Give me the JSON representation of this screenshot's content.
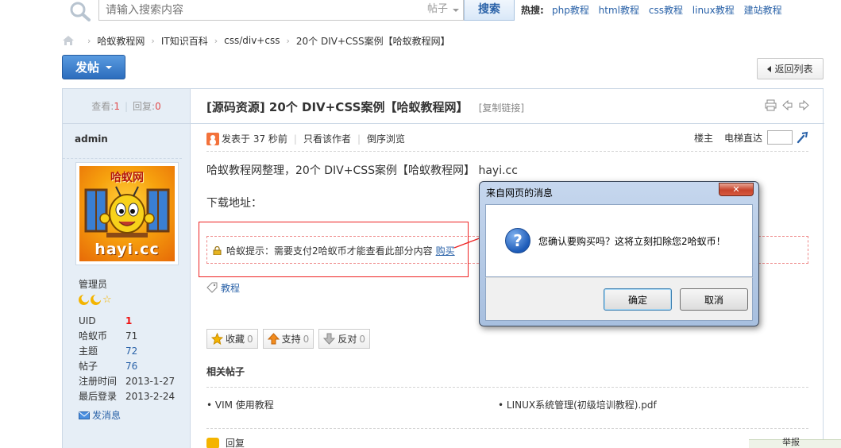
{
  "search": {
    "placeholder": "请输入搜索内容",
    "type_select": "帖子",
    "button_label": "搜索",
    "hot_label": "热搜:",
    "hot_links": [
      "php教程",
      "html教程",
      "css教程",
      "linux教程",
      "建站教程"
    ]
  },
  "breadcrumb": {
    "items": [
      "哈蚁教程网",
      "IT知识百科",
      "css/div+css",
      "20个 DIV+CSS案例【哈蚁教程网】"
    ]
  },
  "toolbar": {
    "post_label": "发帖",
    "back_label": "返回列表"
  },
  "sidebar": {
    "views_label": "查看:",
    "views_value": "1",
    "replies_label": "回复:",
    "replies_value": "0",
    "author": "admin",
    "avatar_title": "哈蚁网",
    "avatar_url_text": "hayi.cc",
    "role": "管理员",
    "meta": [
      {
        "key": "UID",
        "value": "1"
      },
      {
        "key": "哈蚁币",
        "value": "71"
      },
      {
        "key": "主题",
        "value": "72"
      },
      {
        "key": "帖子",
        "value": "76"
      },
      {
        "key": "注册时间",
        "value": "2013-1-27"
      },
      {
        "key": "最后登录",
        "value": "2013-2-24"
      }
    ],
    "send_msg": "发消息"
  },
  "post": {
    "title": "[源码资源] 20个 DIV+CSS案例【哈蚁教程网】",
    "copy_link": "[复制链接]",
    "posted": "发表于 37 秒前",
    "only_author": "只看该作者",
    "reverse": "倒序浏览",
    "floor_label": "楼主",
    "jump_label": "电梯直达",
    "body_line1": "哈蚁教程网整理，20个 DIV+CSS案例【哈蚁教程网】 hayi.cc",
    "body_line2": "下载地址：",
    "hidden_notice": "哈蚁提示：需要支付2哈蚁币才能查看此部分内容",
    "buy_label": "购买",
    "tag": "教程",
    "favorite_label": "收藏",
    "favorite_count": "0",
    "support_label": "支持",
    "support_count": "0",
    "oppose_label": "反对",
    "oppose_count": "0",
    "related_title": "相关帖子",
    "related": [
      "• VIM 使用教程",
      "• LINUX系统管理(初级培训教程).pdf"
    ],
    "reply_label": "回复"
  },
  "dialog": {
    "title": "来自网页的消息",
    "close_label": "✕",
    "message": "您确认要购买吗？这将立刻扣除您2哈蚁币！",
    "ok_label": "确定",
    "cancel_label": "取消"
  },
  "corner": {
    "label": "举报"
  },
  "colors": {
    "link": "#2a62a8",
    "accent_red": "#e14c4c",
    "primary_button": "#2c6dbd",
    "sidebar_bg": "#e6eef6"
  }
}
